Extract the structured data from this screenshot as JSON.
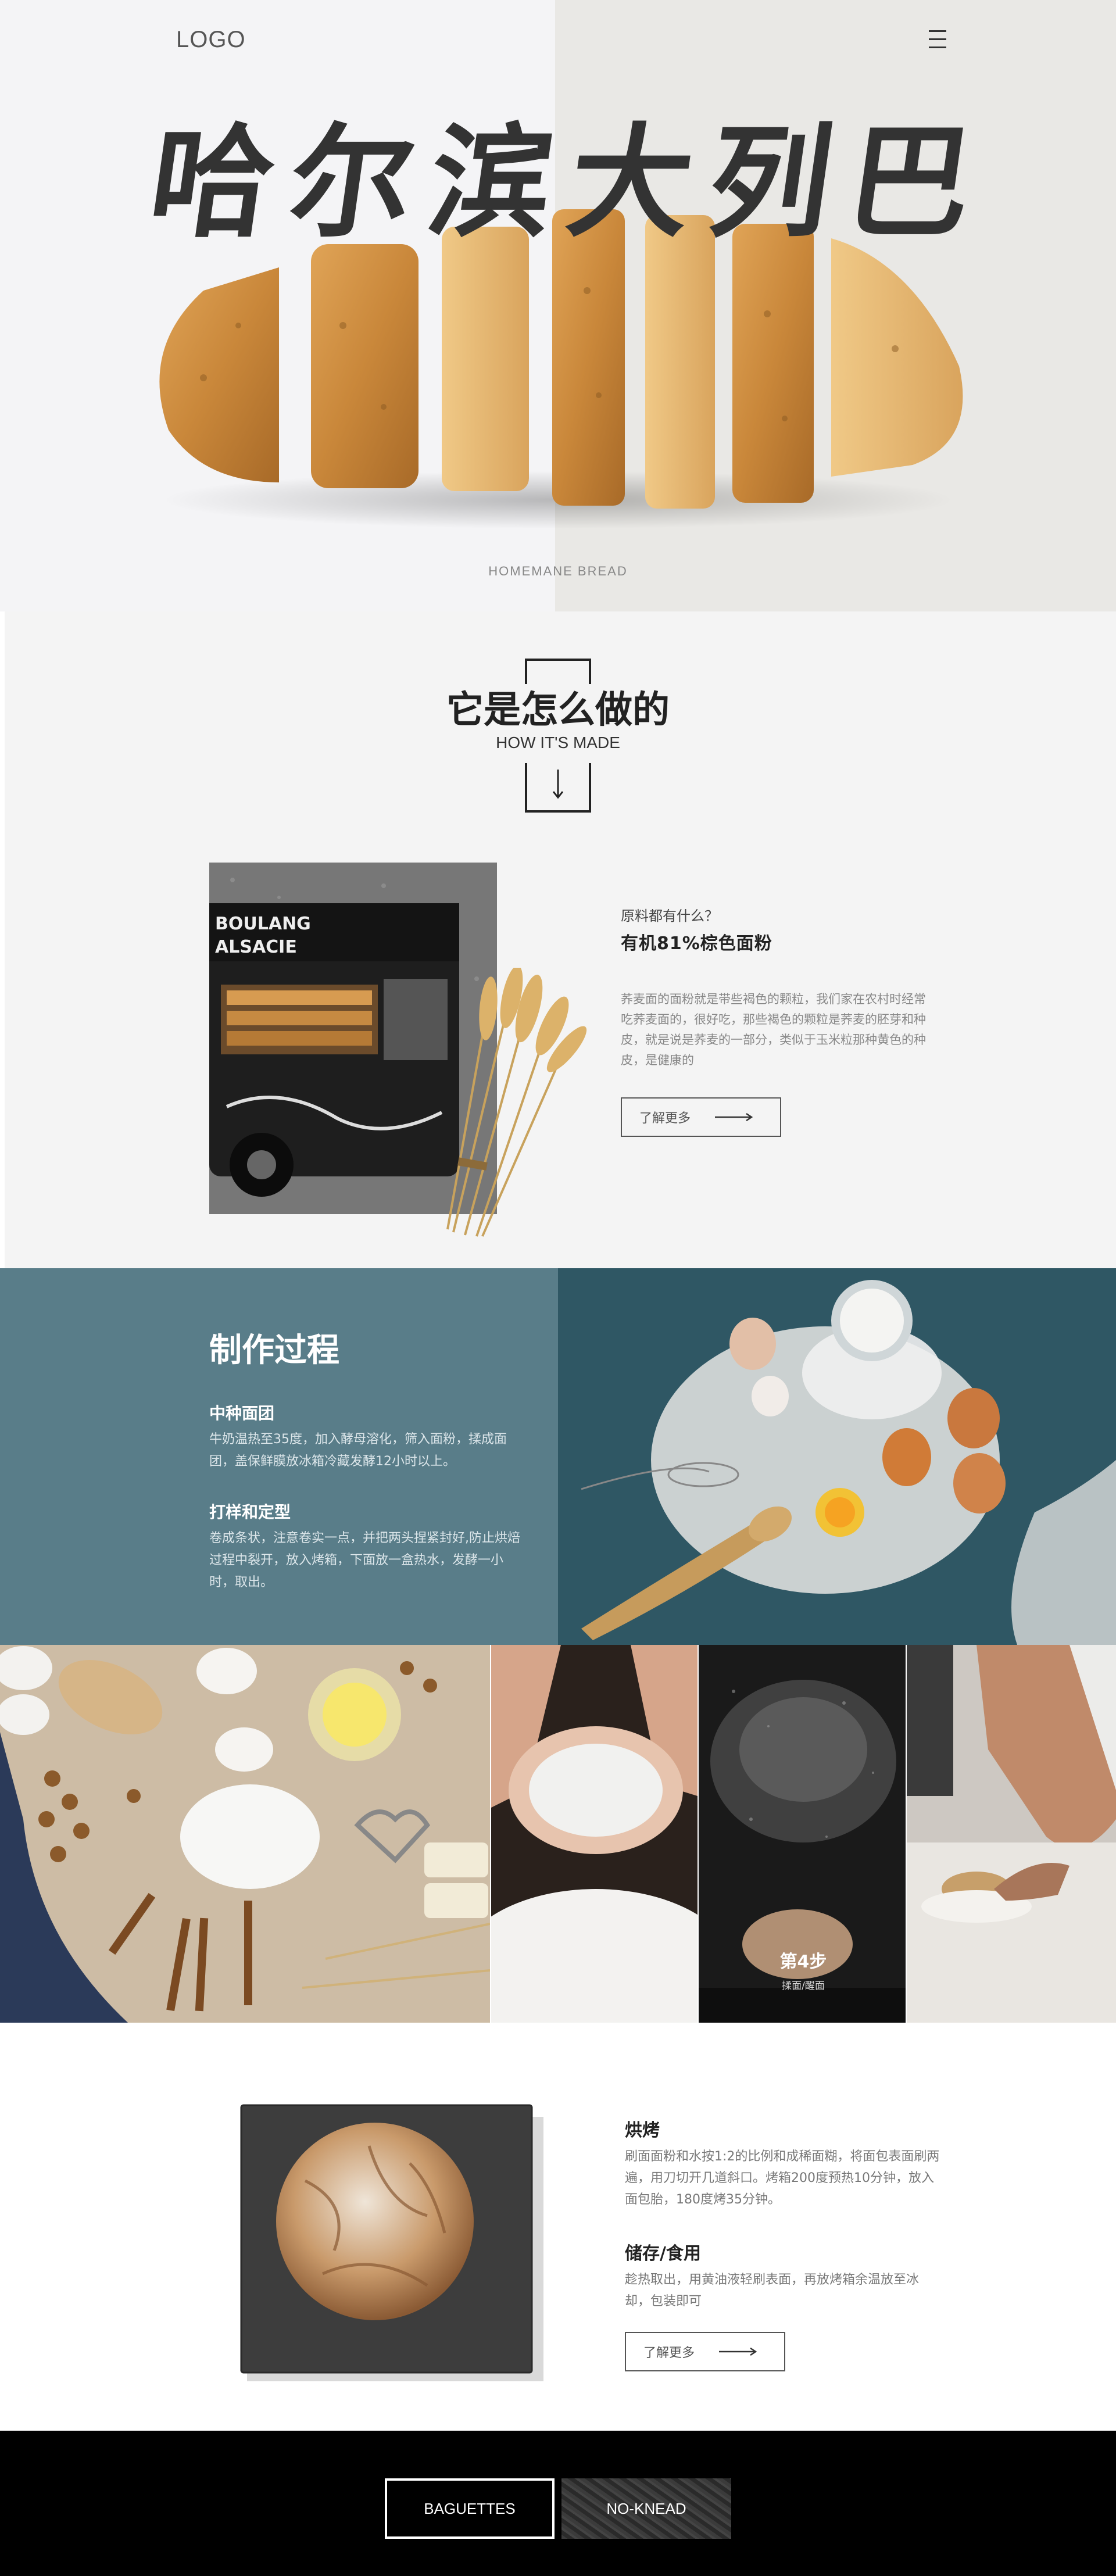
{
  "header": {
    "logo": "LOGO",
    "menu_icon": "menu-icon"
  },
  "hero": {
    "title": "哈尔滨大列巴",
    "caption": "HOMEMANE BREAD"
  },
  "how_made": {
    "title": "它是怎么做的",
    "subtitle": "HOW IT'S MADE",
    "ingredients_label": "原料都有什么？",
    "ingredients_title": "有机81%棕色面粉",
    "ingredients_desc": "荞麦面的面粉就是带些褐色的颗粒，我们家在农村时经常吃荞麦面的，很好吃，那些褐色的颗粒是荞麦的胚芽和种皮，就是说是荞麦的一部分，类似于玉米粒那种黄色的种皮，是健康的",
    "more_button": "了解更多"
  },
  "process": {
    "title": "制作过程",
    "steps": [
      {
        "heading": "中种面团",
        "text": "牛奶温热至35度，加入酵母溶化，筛入面粉，揉成面团，盖保鲜膜放冰箱冷藏发酵12小时以上。"
      },
      {
        "heading": "打样和定型",
        "text": "卷成条状，注意卷实一点，并把两头捏紧封好,防止烘焙过程中裂开，放入烤箱，下面放一盒热水，发酵一小时，取出。"
      }
    ]
  },
  "gallery": {
    "step_label": "第4步",
    "step_sub": "揉面/醒面"
  },
  "bake": {
    "bake_heading": "烘烤",
    "bake_text": "刷面面粉和水按1:2的比例和成稀面糊，将面包表面刷两遍，用刀切开几道斜口。烤箱200度预热10分钟，放入面包胎，180度烤35分钟。",
    "store_heading": "储存/食用",
    "store_text": "趁热取出，用黄油液轻刷表面，再放烤箱余温放至冰却，包装即可",
    "more_button": "了解更多"
  },
  "footer": {
    "tabs": [
      "BAGUETTES",
      "NO-KNEAD"
    ]
  },
  "colors": {
    "process_bg": "#597d89",
    "footer_bg": "#000000",
    "hero_bg": "#f4f4f6"
  }
}
